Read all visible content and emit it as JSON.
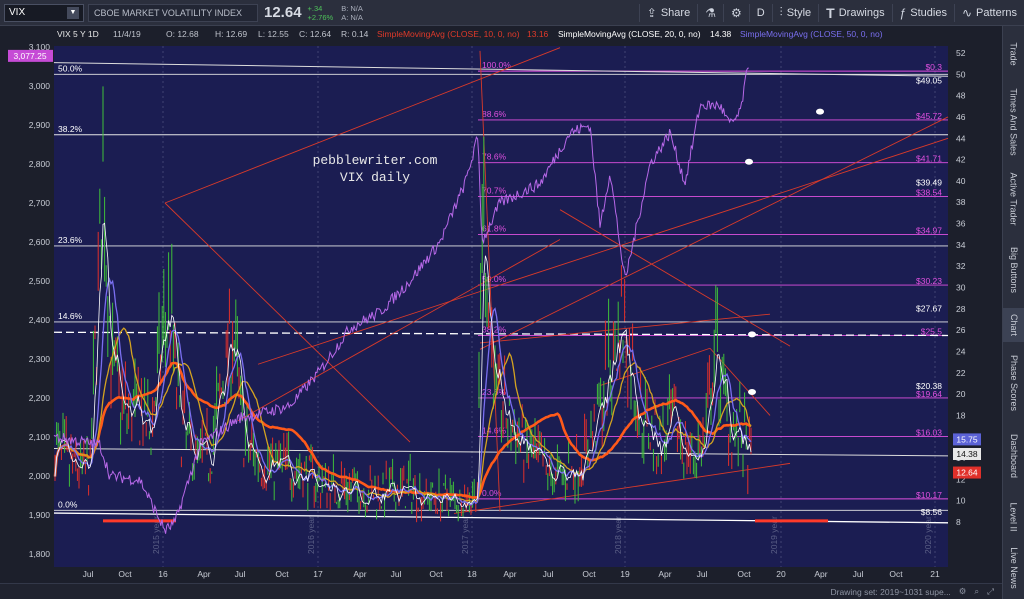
{
  "toolbar": {
    "symbol": "VIX",
    "title": "CBOE MARKET VOLATILITY INDEX",
    "last": "12.64",
    "change": "+.34",
    "change_pct": "+2.76%",
    "bid": "B: N/A",
    "ask": "A: N/A",
    "share": "Share",
    "period": "D",
    "style": "Style",
    "drawings": "Drawings",
    "studies": "Studies",
    "patterns": "Patterns"
  },
  "side_tabs": [
    "Trade",
    "Times And Sales",
    "Active Trader",
    "Big Buttons",
    "Chart",
    "Phase Scores",
    "Dashboard",
    "Level II",
    "Live News"
  ],
  "status": {
    "drawing_set": "Drawing set: 2019~1031 supe..."
  },
  "chart_data": {
    "type": "line",
    "header": {
      "symbol_info": "VIX 5 Y 1D",
      "date": "11/4/19",
      "open": "O: 12.68",
      "high": "H: 12.69",
      "low": "L: 12.55",
      "close": "C: 12.64",
      "range": "R: 0.14",
      "sma10": "SimpleMovingAvg (CLOSE, 10, 0, no)",
      "sma10_val": "13.16",
      "sma20": "SimpleMovingAvg (CLOSE, 20, 0, no)",
      "sma20_val": "14.38",
      "sma50": "SimpleMovingAvg (CLOSE, 50, 0, no)"
    },
    "watermark": [
      "pebblewriter.com",
      "VIX daily"
    ],
    "right_axis": {
      "min": 6,
      "max": 53,
      "ticks": [
        8,
        10,
        12,
        14,
        16,
        18,
        20,
        22,
        24,
        26,
        28,
        30,
        32,
        34,
        36,
        38,
        40,
        42,
        44,
        46,
        48,
        50,
        52
      ]
    },
    "left_axis": {
      "min": 1700,
      "max": 3110,
      "ticks": [
        1800,
        1900,
        2000,
        2100,
        2200,
        2300,
        2400,
        2500,
        2600,
        2700,
        2800,
        2900,
        3000,
        3100
      ],
      "top_badge": "3,077.25"
    },
    "x_ticks": [
      "Jul",
      "Oct",
      "16",
      "Apr",
      "Jul",
      "Oct",
      "17",
      "Apr",
      "Jul",
      "Oct",
      "18",
      "Apr",
      "Jul",
      "Oct",
      "19",
      "Apr",
      "Jul",
      "Oct",
      "20",
      "Apr",
      "Jul",
      "Oct",
      "21"
    ],
    "year_labels": [
      "2015 year",
      "2016 year",
      "2017 year",
      "2018 year",
      "2019 year",
      "2020 year"
    ],
    "left_fib": [
      {
        "label": "50.0%",
        "value": 3030
      },
      {
        "label": "38.2%",
        "value": 2875
      },
      {
        "label": "23.6%",
        "value": 2590
      },
      {
        "label": "14.6%",
        "value": 2395
      },
      {
        "label": "0.0%",
        "value": 1912
      }
    ],
    "right_fib": [
      {
        "label": "100.0%",
        "value": 50.3
      },
      {
        "label": "88.6%",
        "value": 45.72
      },
      {
        "label": "78.6%",
        "value": 41.71
      },
      {
        "label": "70.7%",
        "value": 38.54
      },
      {
        "label": "61.8%",
        "value": 34.97
      },
      {
        "label": "50.0%",
        "value": 30.23
      },
      {
        "label": "38.2%",
        "value": 25.5
      },
      {
        "label": "23.6%",
        "value": 19.64
      },
      {
        "label": "14.6%",
        "value": 16.03
      },
      {
        "label": "0.0%",
        "value": 10.17
      }
    ],
    "price_tags": [
      {
        "text": "$0.3",
        "value": 50.3,
        "color": "#e050e0"
      },
      {
        "text": "$49.05",
        "value": 49.05,
        "color": "#ffffff"
      },
      {
        "text": "$45.72",
        "value": 45.72,
        "color": "#e050e0"
      },
      {
        "text": "$41.71",
        "value": 41.71,
        "color": "#e050e0"
      },
      {
        "text": "$39.49",
        "value": 39.49,
        "color": "#ffffff"
      },
      {
        "text": "$38.54",
        "value": 38.54,
        "color": "#e050e0"
      },
      {
        "text": "$34.97",
        "value": 34.97,
        "color": "#e050e0"
      },
      {
        "text": "$30.23",
        "value": 30.23,
        "color": "#e050e0"
      },
      {
        "text": "$27.67",
        "value": 27.67,
        "color": "#ffffff"
      },
      {
        "text": "$25.5",
        "value": 25.5,
        "color": "#e050e0"
      },
      {
        "text": "$20.38",
        "value": 20.38,
        "color": "#ffffff"
      },
      {
        "text": "$19.64",
        "value": 19.64,
        "color": "#e050e0"
      },
      {
        "text": "$16.03",
        "value": 16.03,
        "color": "#e050e0"
      },
      {
        "text": "$10.17",
        "value": 10.17,
        "color": "#e050e0"
      },
      {
        "text": "$8.56",
        "value": 8.56,
        "color": "#ffffff"
      }
    ],
    "axis_badges": [
      {
        "text": "15.75",
        "value": 15.75,
        "color": "#5b62d6"
      },
      {
        "text": "14.38",
        "value": 14.38,
        "color": "#e8e8e8"
      },
      {
        "text": "12.64",
        "value": 12.64,
        "color": "#e0302a"
      }
    ],
    "colors": {
      "vix": "#e03a2a",
      "sma10": "#ffffff",
      "sma20": "#7a6ff0",
      "sma50": "#d4a320",
      "sma200": "#ff5a1a",
      "spx": "#b768e8",
      "fib": "#e050e0",
      "channel": "#d83a2a"
    }
  }
}
